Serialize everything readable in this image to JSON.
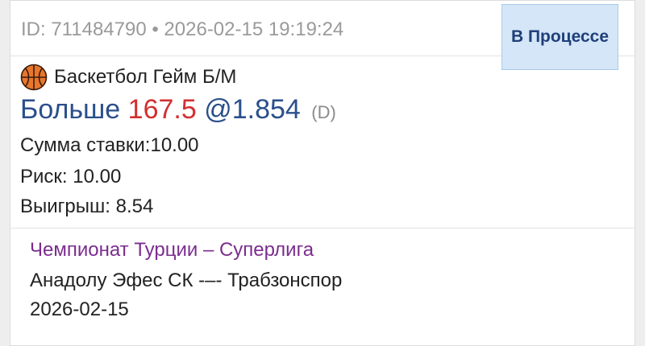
{
  "bet": {
    "id_line": "ID: 711484790 • 2026-02-15 19:19:24",
    "status": "В Процессе",
    "sport_icon": "basketball-icon",
    "sport_label": "Баскетбол Гейм Б/М",
    "selection": {
      "word": "Больше",
      "line": "167.5",
      "odds": "@1.854",
      "flag": "(D)"
    },
    "stake": "Сумма ставки:10.00",
    "risk": "Риск: 10.00",
    "win": "Выигрыш: 8.54"
  },
  "event": {
    "league": "Чемпионат Турции – Суперлига",
    "match": "Анадолу Эфес СК -–- Трабзонспор",
    "date": "2026-02-15"
  },
  "colors": {
    "status_bg": "#d4e6f7",
    "status_text": "#1f3f7a",
    "selection_blue": "#2b4f8c",
    "line_red": "#d32f2f",
    "league_purple": "#7b2d8e"
  }
}
